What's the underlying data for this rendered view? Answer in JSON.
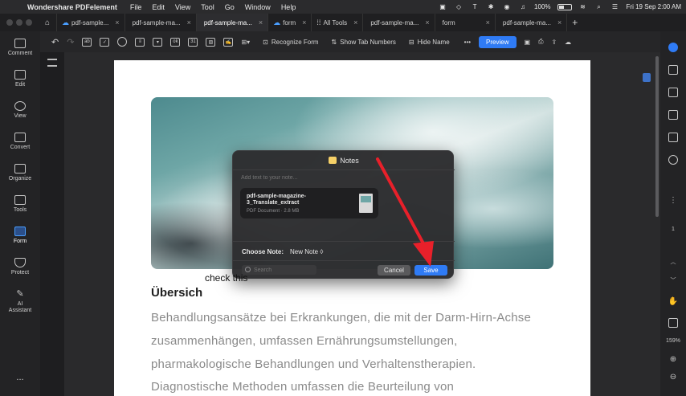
{
  "menubar": {
    "app_name": "Wondershare PDFelement",
    "menus": [
      "File",
      "Edit",
      "View",
      "Tool",
      "Go",
      "Window",
      "Help"
    ],
    "battery": "100%",
    "datetime": "Fri 19 Sep  2:00 AM"
  },
  "tabs": [
    {
      "label": "pdf-sample...",
      "icon": "cloud-icon"
    },
    {
      "label": "pdf-sample-ma...",
      "icon": ""
    },
    {
      "label": "pdf-sample-ma...",
      "icon": "",
      "active": true
    },
    {
      "label": "form",
      "icon": "cloud-icon"
    },
    {
      "label": "All Tools",
      "icon": "grid-icon"
    },
    {
      "label": "pdf-sample-ma...",
      "icon": ""
    },
    {
      "label": "form",
      "icon": ""
    },
    {
      "label": "pdf-sample-ma...",
      "icon": ""
    }
  ],
  "toolbar": {
    "recognize_form": "Recognize Form",
    "show_tab_numbers": "Show Tab Numbers",
    "hide_name": "Hide Name",
    "preview": "Preview"
  },
  "left_sidebar": {
    "items": [
      {
        "label": "Comment",
        "icon": "comment-icon"
      },
      {
        "label": "Edit",
        "icon": "edit-icon"
      },
      {
        "label": "View",
        "icon": "eye-icon"
      },
      {
        "label": "Convert",
        "icon": "convert-icon"
      },
      {
        "label": "Organize",
        "icon": "organize-icon"
      },
      {
        "label": "Tools",
        "icon": "toolbox-icon"
      },
      {
        "label": "Form",
        "icon": "form-icon",
        "active": true
      },
      {
        "label": "Protect",
        "icon": "shield-icon"
      },
      {
        "label": "AI Assistant",
        "icon": "ai-icon"
      }
    ],
    "more": "..."
  },
  "document": {
    "heading": "Übersich",
    "paragraph_lines": [
      "Behandlungsansätze bei Erkrankungen, die mit der Darm-Hirn-Achse",
      "zusammenhängen, umfassen Ernährungsumstellungen,",
      "pharmakologische Behandlungen und Verhaltenstherapien.",
      "Diagnostische Methoden umfassen die Beurteilung von"
    ]
  },
  "right_panel": {
    "page_number": "1",
    "zoom": "159%"
  },
  "notes_dialog": {
    "title": "Notes",
    "placeholder": "Add text to your note...",
    "attachment_name": "pdf-sample-magazine-3_Translate_extract",
    "attachment_meta": "PDF Document · 2.8 MB",
    "choose_note_label": "Choose Note:",
    "choose_note_value": "New Note ◊",
    "search_placeholder": "Search",
    "cancel_label": "Cancel",
    "save_label": "Save"
  },
  "annotation": {
    "text": "check this",
    "arrow_color": "#e8202a"
  },
  "colors": {
    "accent": "#2f7bf5",
    "arrow": "#e8202a"
  }
}
